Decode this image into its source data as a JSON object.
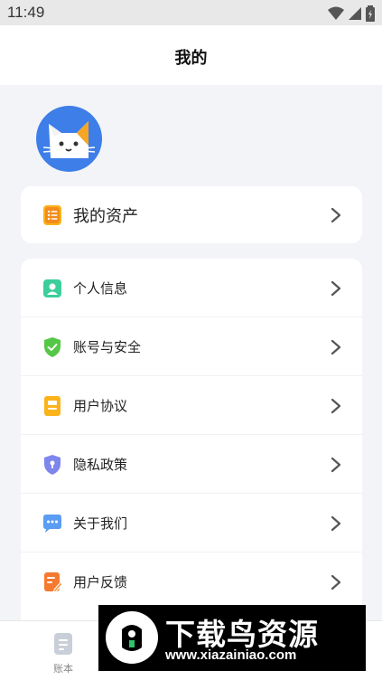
{
  "status_bar": {
    "time": "11:49"
  },
  "header": {
    "title": "我的"
  },
  "assets": {
    "label": "我的资产",
    "icon": "assets-list-icon"
  },
  "menu": {
    "items": [
      {
        "label": "个人信息",
        "icon": "person-info-icon",
        "color": "#3ccf9b"
      },
      {
        "label": "账号与安全",
        "icon": "shield-check-icon",
        "color": "#55c746"
      },
      {
        "label": "用户协议",
        "icon": "document-icon",
        "color": "#fbb31b"
      },
      {
        "label": "隐私政策",
        "icon": "privacy-shield-icon",
        "color": "#7e86ee"
      },
      {
        "label": "关于我们",
        "icon": "chat-bubble-icon",
        "color": "#5b9df2"
      },
      {
        "label": "用户反馈",
        "icon": "feedback-edit-icon",
        "color": "#f5792f"
      }
    ]
  },
  "bottom_nav": {
    "ledger_label": "账本"
  },
  "watermark": {
    "title": "下载鸟资源",
    "url": "www.xiazainiao.com"
  },
  "colors": {
    "background": "#f3f4f7",
    "avatar_bg": "#3d7ee8"
  }
}
